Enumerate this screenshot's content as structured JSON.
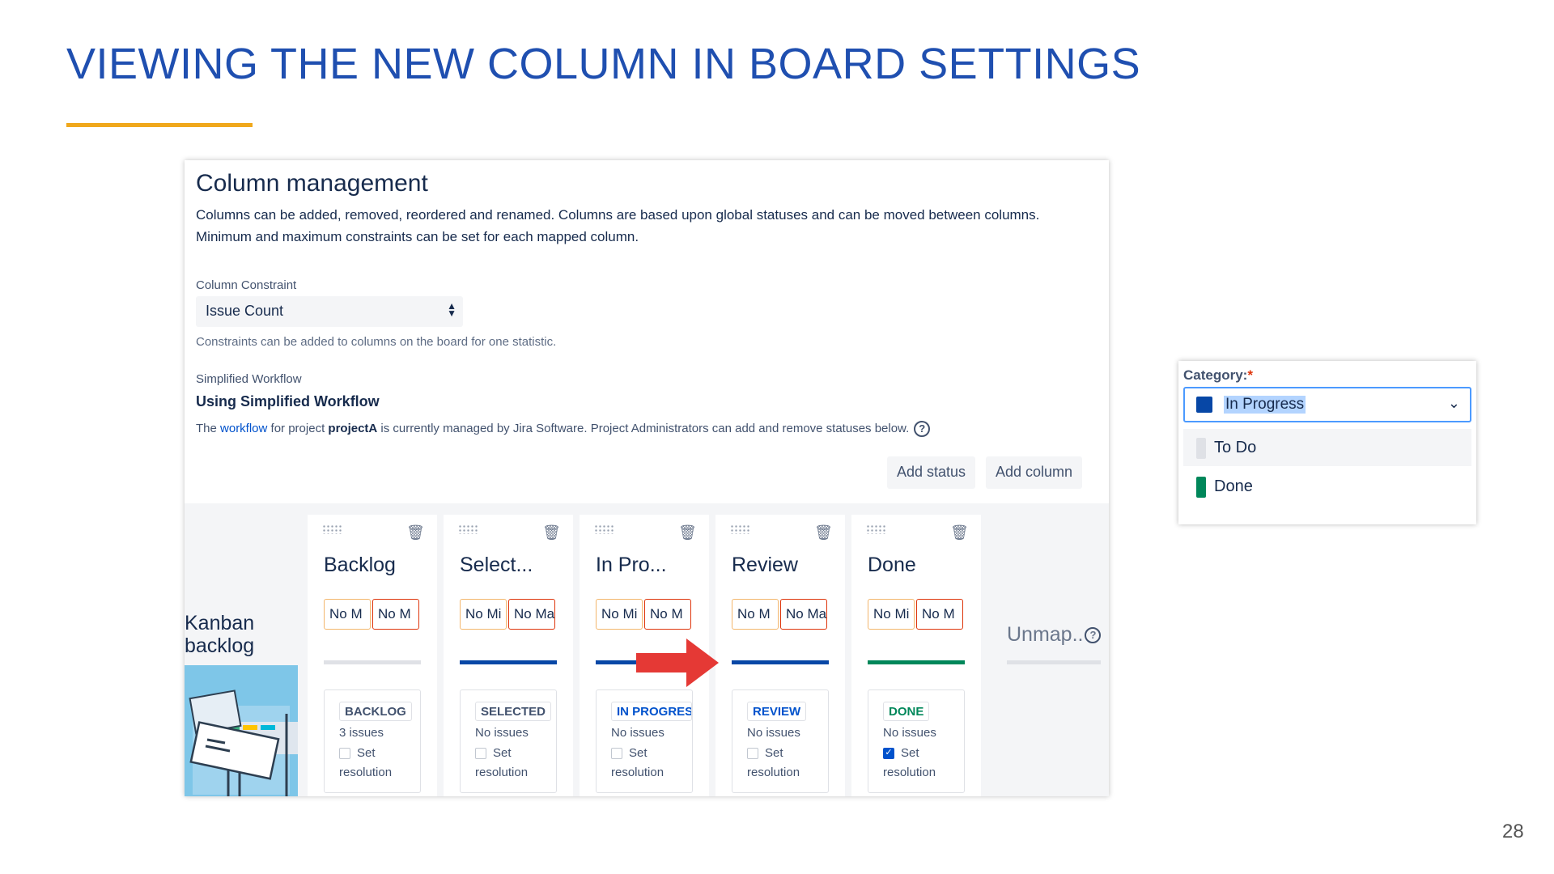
{
  "slide": {
    "title": "VIEWING THE NEW COLUMN IN BOARD SETTINGS",
    "page_number": "28",
    "accent_color": "#1f4fb0",
    "rule_color": "#f0a81c"
  },
  "column_management": {
    "heading": "Column management",
    "description": "Columns can be added, removed, reordered and renamed. Columns are based upon global statuses and can be moved between columns. Minimum and maximum constraints can be set for each mapped column.",
    "constraint_label": "Column Constraint",
    "constraint_value": "Issue Count",
    "constraint_helper": "Constraints can be added to columns on the board for one statistic.",
    "workflow_label": "Simplified Workflow",
    "workflow_title": "Using Simplified Workflow",
    "workflow_text_1": "The ",
    "workflow_link": "workflow",
    "workflow_text_2": " for project ",
    "workflow_project": "projectA",
    "workflow_text_3": " is currently managed by Jira Software. Project Administrators can add and remove statuses below.",
    "add_status": "Add status",
    "add_column": "Add column"
  },
  "board": {
    "kanban_backlog_line1": "Kanban",
    "kanban_backlog_line2": "backlog",
    "unmapped": "Unmap..",
    "columns": [
      {
        "name": "Backlog",
        "min": "No M",
        "max": "No M",
        "status": "BACKLOG",
        "status_color": "#42526e",
        "count": "3 issues",
        "set": "Set",
        "resolution": "resolution",
        "checked": false,
        "bar_color": "#dfe1e6"
      },
      {
        "name": "Select...",
        "min": "No Mi",
        "max": "No Ma",
        "status": "SELECTED",
        "status_color": "#42526e",
        "count": "No issues",
        "set": "Set",
        "resolution": "resolution",
        "checked": false,
        "bar_color": "#0747a6"
      },
      {
        "name": "In Pro...",
        "min": "No Mi",
        "max": "No M",
        "status": "IN PROGRESS",
        "status_color": "#0052cc",
        "count": "No issues",
        "set": "Set",
        "resolution": "resolution",
        "checked": false,
        "bar_color": "#0747a6"
      },
      {
        "name": "Review",
        "min": "No M",
        "max": "No Ma",
        "status": "REVIEW",
        "status_color": "#0052cc",
        "count": "No issues",
        "set": "Set",
        "resolution": "resolution",
        "checked": false,
        "bar_color": "#0747a6"
      },
      {
        "name": "Done",
        "min": "No Mi",
        "max": "No M",
        "status": "DONE",
        "status_color": "#00875a",
        "count": "No issues",
        "set": "Set",
        "resolution": "resolution",
        "checked": true,
        "bar_color": "#00875a"
      }
    ]
  },
  "category": {
    "label": "Category:",
    "required_mark": "*",
    "selected": "In Progress",
    "selected_color": "#0747a6",
    "options": [
      {
        "label": "To Do",
        "color": "#dfe1e6"
      },
      {
        "label": "Done",
        "color": "#00875a"
      }
    ]
  },
  "icons": [
    "drag-handle-icon",
    "trash-icon",
    "help-icon",
    "chevron-down-icon",
    "red-arrow-icon",
    "checkbox-icon"
  ]
}
